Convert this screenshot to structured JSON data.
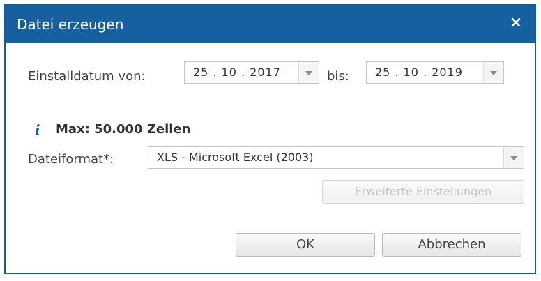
{
  "dialog": {
    "title": "Datei erzeugen",
    "close_label": "×"
  },
  "date_range": {
    "from_label": "Einstalldatum von:",
    "from_value": "25 . 10 . 2017",
    "to_label": "bis:",
    "to_value": "25 . 10 . 2019"
  },
  "info": {
    "icon": "i",
    "text": "Max: 50.000 Zeilen"
  },
  "format": {
    "label": "Dateiformat*:",
    "value": "XLS - Microsoft Excel (2003)"
  },
  "buttons": {
    "advanced": "Erweiterte Einstellungen",
    "ok": "OK",
    "cancel": "Abbrechen"
  },
  "colors": {
    "titlebar": "#17609f",
    "info_icon": "#17609f"
  }
}
